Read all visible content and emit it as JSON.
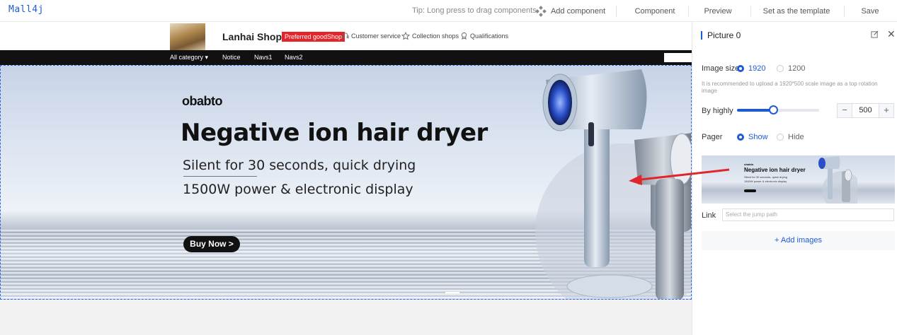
{
  "app": {
    "logo": "Mall4j"
  },
  "topbar": {
    "tip": "Tip: Long press to drag components",
    "add_component": "Add component",
    "component": "Component",
    "preview": "Preview",
    "set_template": "Set as the template",
    "save": "Save"
  },
  "shop": {
    "name": "Lanhai Shop",
    "badge": "Preferred goodShop",
    "links": [
      "Customer service",
      "Collection shops",
      "Qualifications"
    ]
  },
  "nav": {
    "items": [
      "All category ▾",
      "Notice",
      "Navs1",
      "Navs2"
    ]
  },
  "banner": {
    "brand": "obabto",
    "title": "Negative ion hair dryer",
    "subtitle1": "Silent for 30 seconds, quick drying",
    "subtitle2": "1500W power & electronic display",
    "button": "Buy Now >"
  },
  "panel": {
    "title": "Picture 0",
    "image_size_label": "Image size",
    "image_size_options": [
      "1920",
      "1200"
    ],
    "image_size_selected": "1920",
    "hint": "It is recommended to upload a 1920*500 scale image as a top rotation image",
    "height_label": "By highly",
    "height_value": "500",
    "height_fraction": 0.44,
    "pager_label": "Pager",
    "pager_options": [
      "Show",
      "Hide"
    ],
    "pager_selected": "Show",
    "link_label": "Link",
    "link_placeholder": "Select the jump path",
    "add_images": "+ Add images"
  },
  "colors": {
    "accent": "#1d5bd6",
    "badge": "#e3242b",
    "arrow": "#e0262b"
  }
}
